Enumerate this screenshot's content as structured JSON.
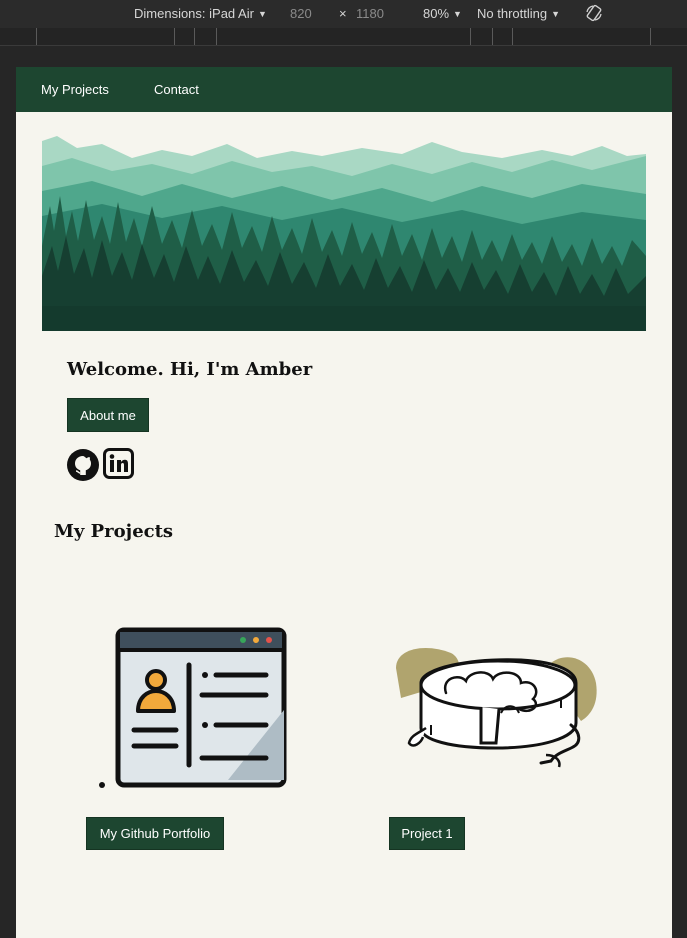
{
  "devtools": {
    "dimensions_label": "Dimensions: iPad Air",
    "width": "820",
    "times": "×",
    "height": "1180",
    "zoom": "80%",
    "throttling": "No throttling",
    "rotate_icon": "rotate-icon"
  },
  "nav": {
    "items": [
      "My Projects",
      "Contact"
    ]
  },
  "hero": {
    "image": "mountain-forest-illustration"
  },
  "welcome": {
    "heading": "Welcome. Hi, I'm Amber",
    "about_button": "About me"
  },
  "social": {
    "icons": [
      "github-icon",
      "linkedin-icon"
    ]
  },
  "projects": {
    "title": "My Projects",
    "items": [
      {
        "label": "My Github Portfolio",
        "image": "profile-window-illustration"
      },
      {
        "label": "Project 1",
        "image": "pie-illustration"
      }
    ]
  },
  "colors": {
    "nav_bg": "#1d4630",
    "page_bg": "#f6f5ee",
    "button_bg": "#1d4630",
    "accent_gold": "#b0a46e"
  }
}
